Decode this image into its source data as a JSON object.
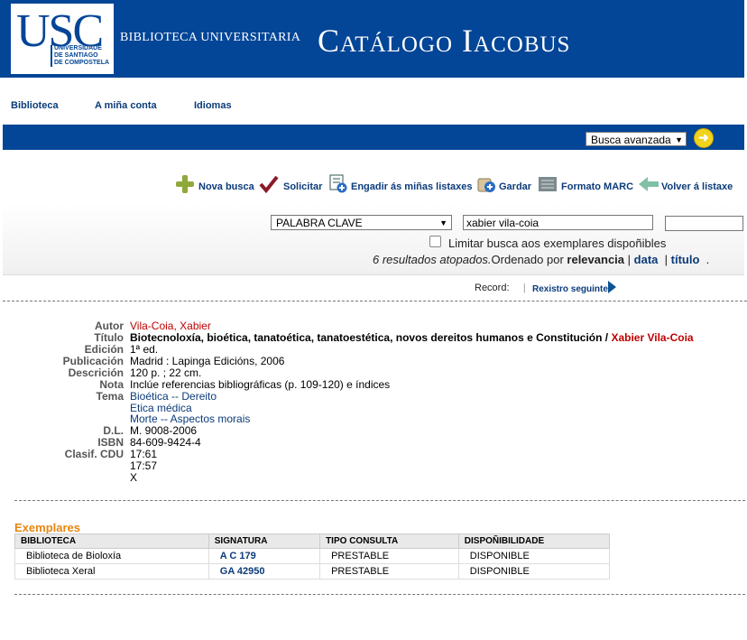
{
  "header": {
    "logo_letters": "USC",
    "logo_sub": [
      "UNIVERSIDADE",
      "DE SANTIAGO",
      "DE COMPOSTELA"
    ],
    "library_name": "BIBLIOTECA UNIVERSITARIA",
    "catalog_title": "Catálogo Iacobus"
  },
  "topnav": [
    "Biblioteca",
    "A miña conta",
    "Idiomas"
  ],
  "search_bar": {
    "advanced_select": "Busca avanzada"
  },
  "toolbar": {
    "new_search": "Nova busca",
    "request": "Solicitar",
    "add_lists": "Engadir ás miñas listaxes",
    "save": "Gardar",
    "marc": "Formato MARC",
    "back": "Volver á listaxe"
  },
  "search": {
    "field": "PALABRA CLAVE",
    "query": "xabier vila-coia",
    "limit_label": "Limitar busca aos exemplares dispoñibles",
    "results_count": "6 resultados atopados.",
    "sorted_by": "Ordenado por",
    "sort_relevance": "relevancia",
    "sort_date": "data",
    "sort_title": "título",
    "separator": "|",
    "dot": "."
  },
  "record_nav": {
    "label": "Record:",
    "separator": "|",
    "next": "Rexistro seguinte"
  },
  "record": {
    "labels": {
      "author": "Autor",
      "title": "Título",
      "edition": "Edición",
      "publication": "Publicación",
      "description": "Descrición",
      "note": "Nota",
      "subject": "Tema",
      "dl": "D.L.",
      "isbn": "ISBN",
      "cdu": "Clasif. CDU"
    },
    "author": "Vila-Coia, Xabier",
    "title_main": "Biotecnoloxía, bioética, tanatoética, tanatoestética, novos dereitos humanos e Constitución /",
    "title_resp": "Xabier Vila-Coia",
    "edition": "1ª ed.",
    "publication": "Madrid : Lapinga Edicións, 2006",
    "description": "120 p. ; 22 cm.",
    "note": "Inclúe referencias bibliográficas (p. 109-120) e índices",
    "subjects": [
      "Bioética -- Dereito",
      "Etica médica",
      "Morte -- Aspectos morais"
    ],
    "dl": "M. 9008-2006",
    "isbn": "84-609-9424-4",
    "cdu": [
      "17:61",
      "17:57",
      "X"
    ]
  },
  "holdings": {
    "title": "Exemplares",
    "headers": [
      "BIBLIOTECA",
      "SIGNATURA",
      "TIPO CONSULTA",
      "DISPOÑIBILIDADE"
    ],
    "rows": [
      [
        "Biblioteca de Bioloxía",
        "A C 179",
        "PRESTABLE",
        "DISPONIBLE"
      ],
      [
        "Biblioteca Xeral",
        "GA 42950",
        "PRESTABLE",
        "DISPONIBLE"
      ]
    ]
  }
}
